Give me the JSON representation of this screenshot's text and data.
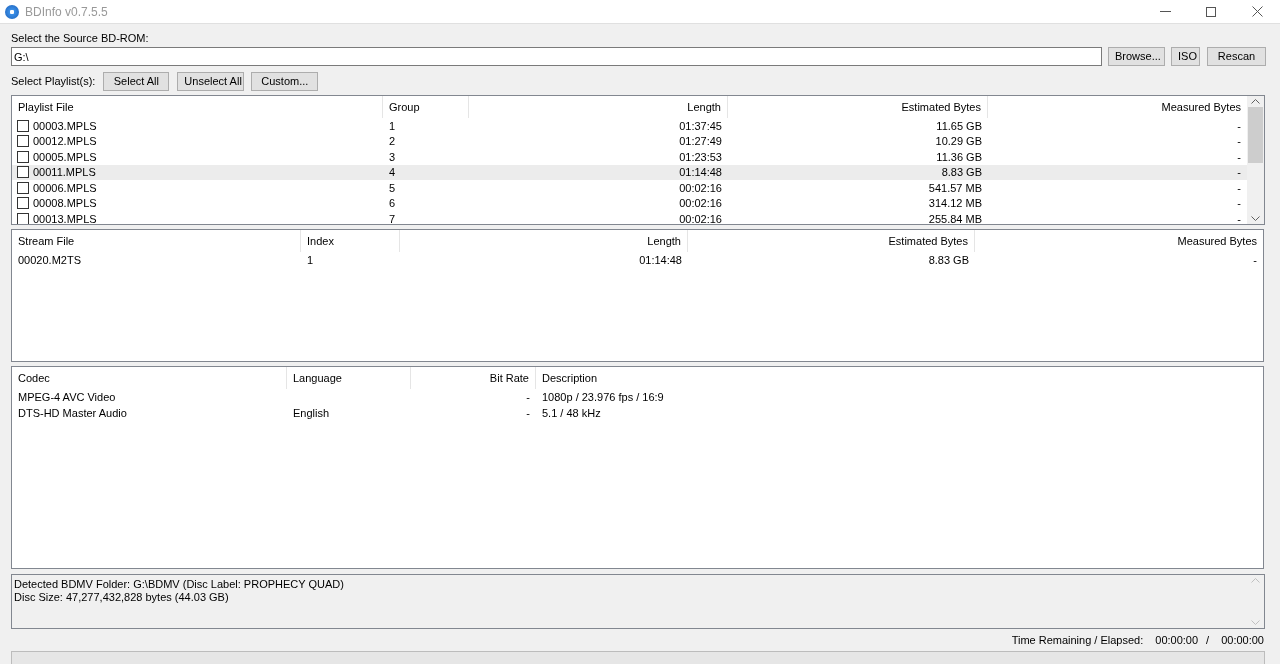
{
  "window": {
    "title": "BDInfo v0.7.5.5"
  },
  "source": {
    "label": "Select the Source BD-ROM:",
    "value": "G:\\",
    "buttons": [
      "Browse...",
      "ISO",
      "Rescan"
    ]
  },
  "playlist_select": {
    "label": "Select Playlist(s):",
    "buttons": [
      "Select All",
      "Unselect All",
      "Custom..."
    ]
  },
  "playlists": {
    "columns": [
      "Playlist File",
      "Group",
      "Length",
      "Estimated Bytes",
      "Measured Bytes"
    ],
    "rows": [
      {
        "file": "00003.MPLS",
        "group": "1",
        "length": "01:37:45",
        "estimated": "11.65 GB",
        "measured": "-",
        "checked": false,
        "selected": false
      },
      {
        "file": "00012.MPLS",
        "group": "2",
        "length": "01:27:49",
        "estimated": "10.29 GB",
        "measured": "-",
        "checked": false,
        "selected": false
      },
      {
        "file": "00005.MPLS",
        "group": "3",
        "length": "01:23:53",
        "estimated": "11.36 GB",
        "measured": "-",
        "checked": false,
        "selected": false
      },
      {
        "file": "00011.MPLS",
        "group": "4",
        "length": "01:14:48",
        "estimated": "8.83 GB",
        "measured": "-",
        "checked": false,
        "selected": true
      },
      {
        "file": "00006.MPLS",
        "group": "5",
        "length": "00:02:16",
        "estimated": "541.57 MB",
        "measured": "-",
        "checked": false,
        "selected": false
      },
      {
        "file": "00008.MPLS",
        "group": "6",
        "length": "00:02:16",
        "estimated": "314.12 MB",
        "measured": "-",
        "checked": false,
        "selected": false
      },
      {
        "file": "00013.MPLS",
        "group": "7",
        "length": "00:02:16",
        "estimated": "255.84 MB",
        "measured": "-",
        "checked": false,
        "selected": false
      }
    ]
  },
  "streams": {
    "columns": [
      "Stream File",
      "Index",
      "Length",
      "Estimated Bytes",
      "Measured Bytes"
    ],
    "rows": [
      [
        "00020.M2TS",
        "1",
        "01:14:48",
        "8.83 GB",
        "-"
      ]
    ]
  },
  "codecs": {
    "columns": [
      "Codec",
      "Language",
      "Bit Rate",
      "Description"
    ],
    "rows": [
      [
        "MPEG-4 AVC Video",
        "",
        "-",
        "1080p / 23.976 fps / 16:9"
      ],
      [
        "DTS-HD Master Audio",
        "English",
        "-",
        "5.1 / 48 kHz"
      ]
    ]
  },
  "report": [
    "Detected BDMV Folder: G:\\BDMV (Disc Label: PROPHECY QUAD)",
    "Disc Size: 47,277,432,828 bytes (44.03 GB)"
  ],
  "progress": {
    "level": 0
  },
  "status": {
    "label": "Time Remaining / Elapsed:",
    "remaining": "00:00:00",
    "separator": "/",
    "elapsed": "00:00:00"
  }
}
